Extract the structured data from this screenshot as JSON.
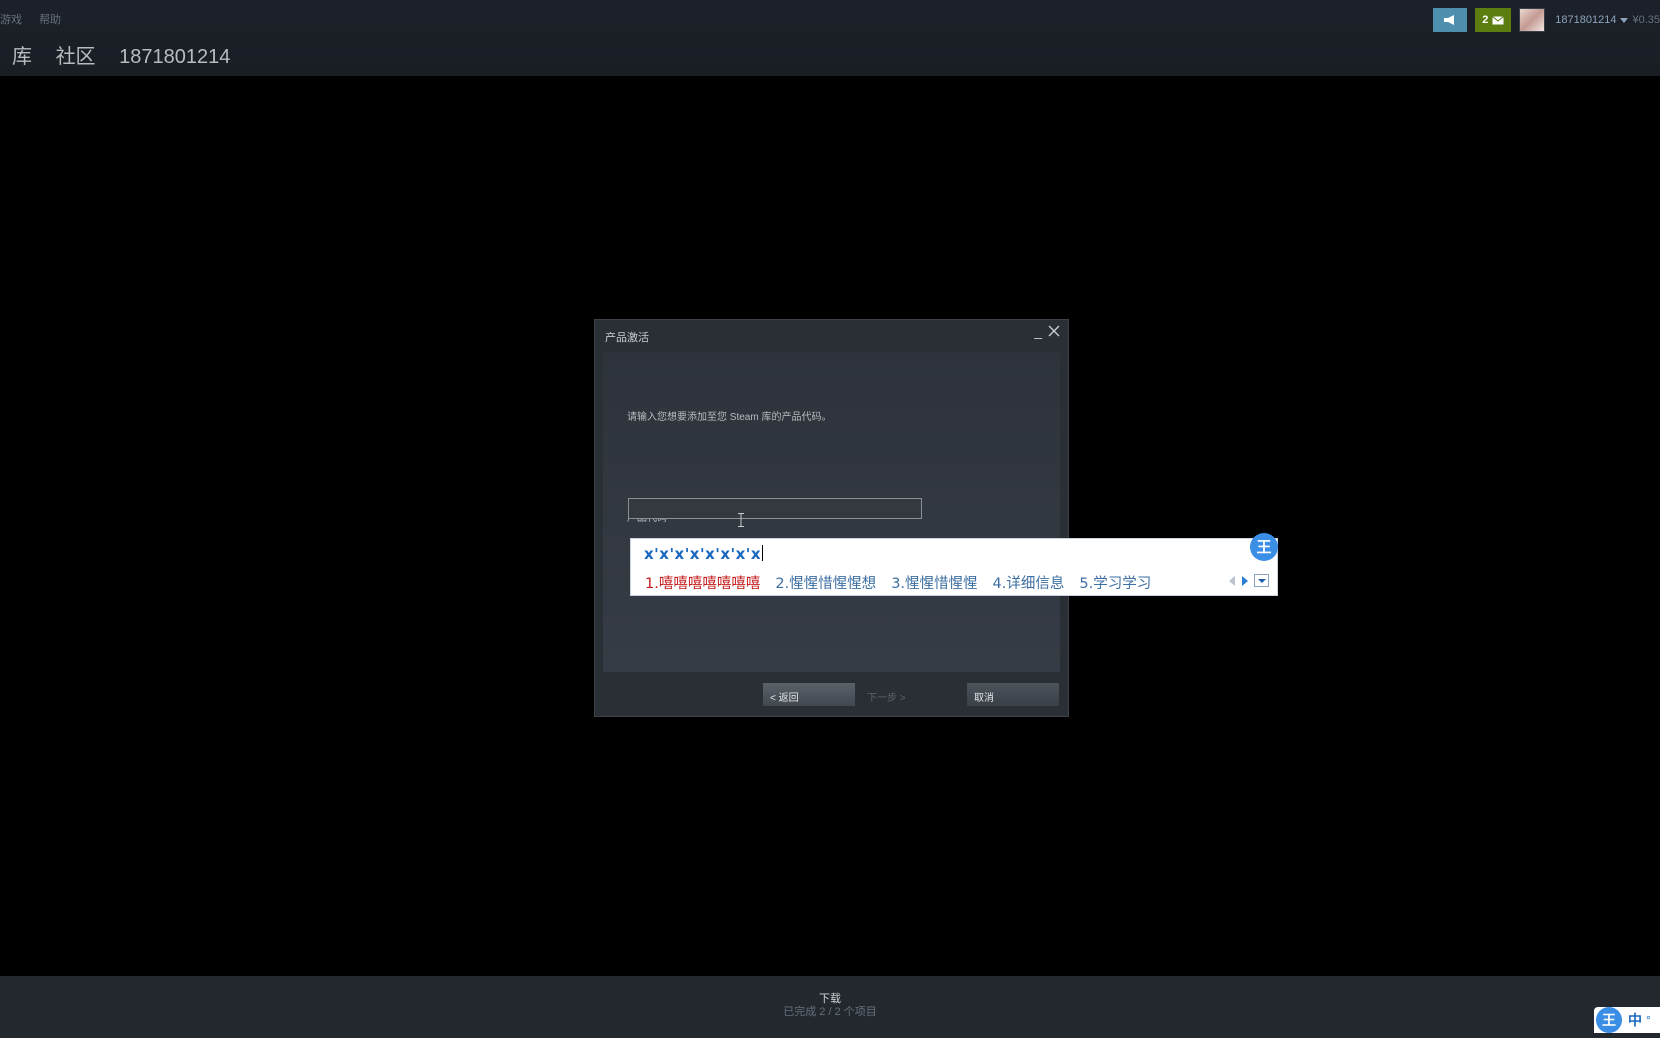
{
  "menu": {
    "items": [
      "游戏",
      "帮助"
    ]
  },
  "nav": {
    "library": "库",
    "community": "社区",
    "username": "1871801214"
  },
  "top_right": {
    "notification_count": "2",
    "account_name": "1871801214",
    "balance": "¥0.35"
  },
  "dialog": {
    "title": "产品激活",
    "minimize": "_",
    "instruction": "请输入您想要添加至您 Steam 库的产品代码。",
    "code_label": "产品代码",
    "code_value": "",
    "buttons": {
      "back": "< 返回",
      "next": "下一步 >",
      "cancel": "取消"
    }
  },
  "ime": {
    "composition": "x'x'x'x'x'x'x'x",
    "candidates": [
      "1.嘻嘻嘻嘻嘻嘻嘻",
      "2.惺惺惜惺惺想",
      "3.惺惺惜惺惺",
      "4.详细信息",
      "5.学习学习"
    ],
    "logo": "王",
    "tray_mode": "中",
    "tray_punct": "°"
  },
  "download": {
    "title": "下载",
    "status": "已完成 2 / 2 个项目"
  },
  "colors": {
    "accent": "#4e8fad",
    "notif": "#5c7e10",
    "ime_selected": "#c41a1a",
    "ime_blue": "#1a67c0"
  }
}
